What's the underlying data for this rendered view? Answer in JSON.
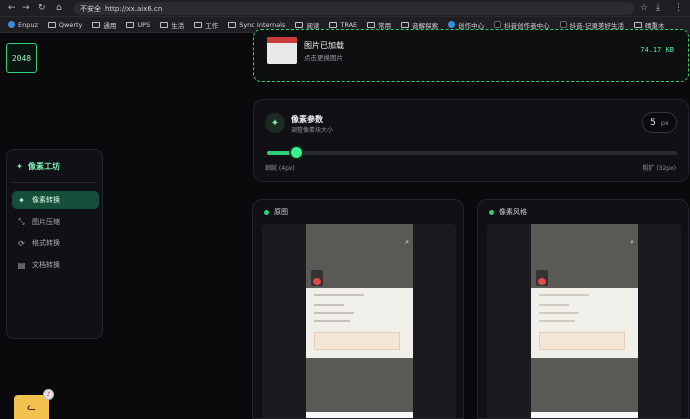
{
  "browser": {
    "security": "不安全",
    "url": "http://xx.aix6.cn",
    "bookmarks": [
      "Enpuz",
      "Qwerty",
      "通用",
      "UPS",
      "生活",
      "工作",
      "Sync Internals",
      "阅读",
      "TRAE",
      "常用",
      "音解探索",
      "创作中心",
      "抖音创作者中心",
      "抖音-记录美好生活",
      "晴重木"
    ]
  },
  "logo": "2048",
  "sidebar": {
    "title": "像素工坊",
    "items": [
      {
        "label": "像素转换",
        "icon": "sparkle-icon",
        "active": true
      },
      {
        "label": "图片压缩",
        "icon": "compress-icon",
        "active": false
      },
      {
        "label": "格式转换",
        "icon": "refresh-icon",
        "active": false
      },
      {
        "label": "文档转换",
        "icon": "document-icon",
        "active": false
      }
    ]
  },
  "upload": {
    "title": "图片已加载",
    "subtitle": "点击更换图片",
    "size": "74.17 KB"
  },
  "params": {
    "title": "像素参数",
    "subtitle": "调整像素块大小",
    "value": "5",
    "unit": "px",
    "slider_fraction": 0.07,
    "min_label": "细腻 (4px)",
    "max_label": "粗犷 (32px)"
  },
  "panels": {
    "original": "原图",
    "pixel": "像素风格"
  },
  "colors": {
    "accent": "#2ecf7a",
    "background": "#0a0a0c",
    "active_item": "#17503a"
  }
}
